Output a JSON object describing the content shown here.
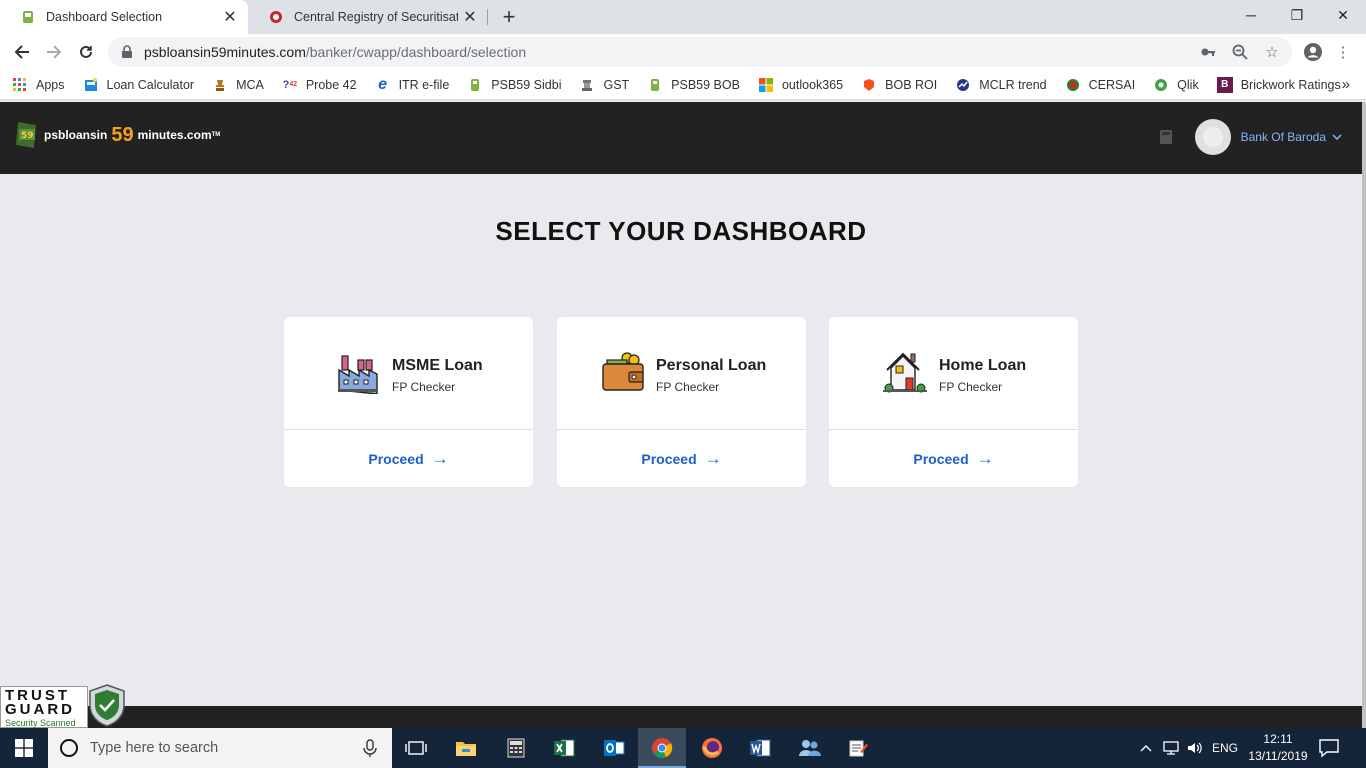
{
  "browser": {
    "tabs": [
      {
        "title": "Dashboard Selection",
        "active": true
      },
      {
        "title": "Central Registry of Securitisation",
        "active": false
      }
    ],
    "url_host": "psbloansin59minutes.com",
    "url_path": "/banker/cwapp/dashboard/selection",
    "bookmarks": [
      {
        "label": "Apps",
        "icon": "apps-grid-icon"
      },
      {
        "label": "Loan Calculator",
        "icon": "calculator-icon"
      },
      {
        "label": "MCA",
        "icon": "emblem-icon"
      },
      {
        "label": "Probe 42",
        "icon": "probe42-icon"
      },
      {
        "label": "ITR e-file",
        "icon": "ie-icon"
      },
      {
        "label": "PSB59 Sidbi",
        "icon": "psb59-icon"
      },
      {
        "label": "GST",
        "icon": "emblem-icon"
      },
      {
        "label": "PSB59 BOB",
        "icon": "psb59-icon"
      },
      {
        "label": "outlook365",
        "icon": "microsoft-icon"
      },
      {
        "label": "BOB ROI",
        "icon": "bob-icon"
      },
      {
        "label": "MCLR trend",
        "icon": "mclr-icon"
      },
      {
        "label": "CERSAI",
        "icon": "cersai-icon"
      },
      {
        "label": "Qlik",
        "icon": "qlik-icon"
      },
      {
        "label": "Brickwork Ratings",
        "icon": "brickwork-icon"
      }
    ]
  },
  "header": {
    "logo_prefix": "psbloansin",
    "logo_number": "59",
    "logo_suffix": "minutes.com",
    "logo_badge": "59",
    "logo_tm": "TM",
    "user_name": "Bank Of Baroda"
  },
  "main": {
    "title": "SELECT YOUR DASHBOARD",
    "cards": [
      {
        "title": "MSME Loan",
        "subtitle": "FP Checker",
        "action": "Proceed",
        "icon": "factory-icon"
      },
      {
        "title": "Personal Loan",
        "subtitle": "FP Checker",
        "action": "Proceed",
        "icon": "wallet-icon"
      },
      {
        "title": "Home Loan",
        "subtitle": "FP Checker",
        "action": "Proceed",
        "icon": "house-icon"
      }
    ]
  },
  "trust_badge": {
    "line1": "TRUST",
    "line2": "GUARD",
    "line3": "Security Scanned"
  },
  "taskbar": {
    "search_placeholder": "Type here to search",
    "language": "ENG",
    "time": "12:11",
    "date": "13/11/2019"
  },
  "colors": {
    "header_bg": "#222222",
    "accent_orange": "#f7a21b",
    "link_blue": "#1d5fc9",
    "page_bg": "#e9eaed"
  }
}
